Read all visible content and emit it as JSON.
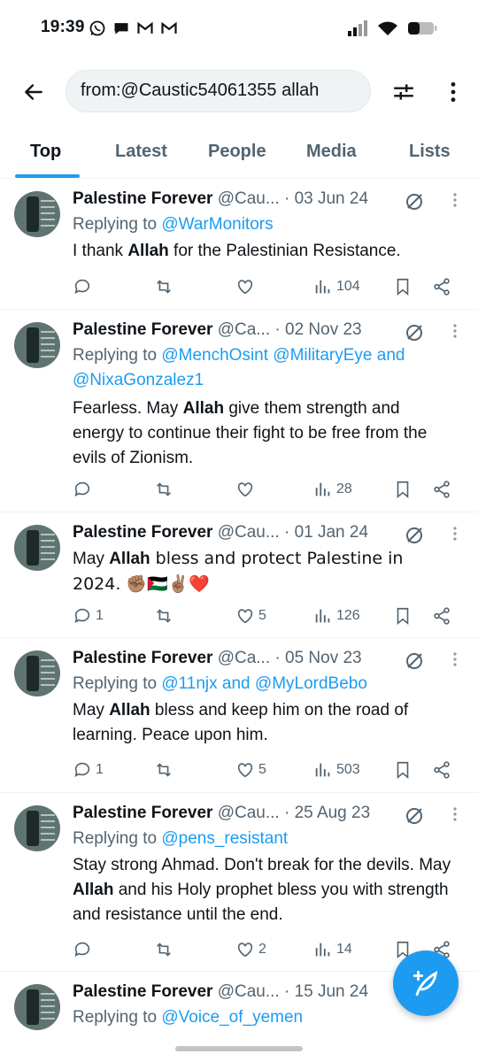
{
  "status_bar": {
    "time": "19:39"
  },
  "search": {
    "query": "from:@Caustic54061355 allah"
  },
  "tabs": [
    {
      "label": "Top"
    },
    {
      "label": "Latest"
    },
    {
      "label": "People"
    },
    {
      "label": "Media"
    },
    {
      "label": "Lists"
    }
  ],
  "colors": {
    "accent": "#1d9bf0",
    "text": "#0f1419",
    "secondary": "#536471"
  },
  "tweets": [
    {
      "name": "Palestine Forever",
      "handle": "@Cau...",
      "date": "· 03 Jun 24",
      "reply_prefix": "Replying to ",
      "reply_to": "@WarMonitors",
      "text_before": "I thank ",
      "keyword": "Allah",
      "text_after": " for the Palestinian Resistance.",
      "replies": "",
      "retweets": "",
      "likes": "",
      "views": "104"
    },
    {
      "name": "Palestine Forever",
      "handle": "@Ca...",
      "date": "· 02 Nov 23",
      "reply_prefix": "Replying to ",
      "reply_to": "@MenchOsint @MilitaryEye and @NixaGonzalez1",
      "text_before": "Fearless. May ",
      "keyword": "Allah",
      "text_after": " give them strength and energy to continue their fight to be free from the evils of Zionism.",
      "replies": "",
      "retweets": "",
      "likes": "",
      "views": "28"
    },
    {
      "name": "Palestine Forever",
      "handle": "@Cau...",
      "date": "· 01 Jan 24",
      "reply_prefix": "",
      "reply_to": "",
      "text_before": "May ",
      "keyword": "Allah",
      "text_after": " bless and protect Palestine in 2024. ✊🏽🇵🇸✌🏽❤️",
      "replies": "1",
      "retweets": "",
      "likes": "5",
      "views": "126"
    },
    {
      "name": "Palestine Forever",
      "handle": "@Ca...",
      "date": "· 05 Nov 23",
      "reply_prefix": "Replying to ",
      "reply_to": "@11njx and @MyLordBebo",
      "text_before": "May ",
      "keyword": "Allah",
      "text_after": " bless and keep him on the road of learning. Peace upon him.",
      "replies": "1",
      "retweets": "",
      "likes": "5",
      "views": "503"
    },
    {
      "name": "Palestine Forever",
      "handle": "@Cau...",
      "date": "· 25 Aug 23",
      "reply_prefix": "Replying to ",
      "reply_to": "@pens_resistant",
      "text_before": "Stay strong Ahmad. Don't break for the devils. May ",
      "keyword": "Allah",
      "text_after": " and his Holy prophet bless you with strength and resistance until the end.",
      "replies": "",
      "retweets": "",
      "likes": "2",
      "views": "14"
    },
    {
      "name": "Palestine Forever",
      "handle": "@Cau...",
      "date": "· 15 Jun 24",
      "reply_prefix": "Replying to ",
      "reply_to": "@Voice_of_yemen",
      "text_before": "",
      "keyword": "",
      "text_after": "",
      "replies": "",
      "retweets": "",
      "likes": "",
      "views": ""
    }
  ]
}
